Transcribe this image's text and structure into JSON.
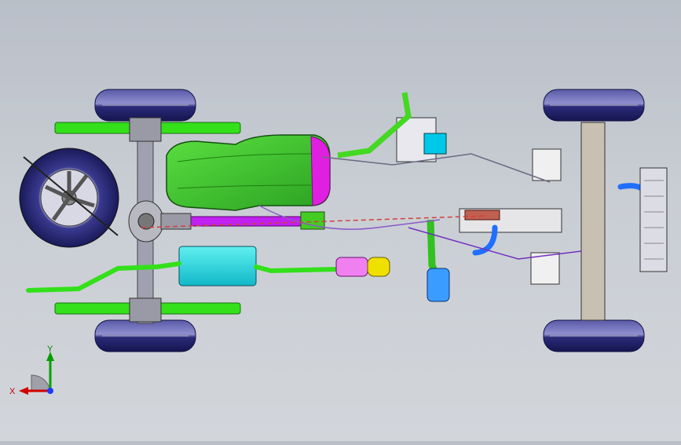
{
  "viewport": {
    "background_top": "#b9bfc8",
    "background_bottom": "#d2d5da"
  },
  "triad": {
    "x_label": "X",
    "y_label": "Y",
    "x_color": "#d10000",
    "y_color": "#00a000",
    "z_color": "#1a3cff"
  },
  "model": {
    "colors": {
      "frame_green": "#33e01a",
      "tank_green": "#3dcc33",
      "tank_magenta": "#e020e0",
      "tire_blue": "#2a2a78",
      "muffler_cyan": "#20e0e0",
      "catalyst_pink": "#f080f0",
      "catalyst_yellow": "#f0e000",
      "driveshaft_purple": "#c020f0",
      "hose_blue": "#1f6fff",
      "steel_grey": "#b8b8c0"
    },
    "icons": {
      "tire": "tire-icon",
      "spare": "spare-wheel-icon",
      "tank": "fuel-tank-icon",
      "muffler": "muffler-icon",
      "axle": "rear-axle-icon",
      "steering": "steering-column-icon",
      "radiator": "radiator-icon"
    }
  }
}
